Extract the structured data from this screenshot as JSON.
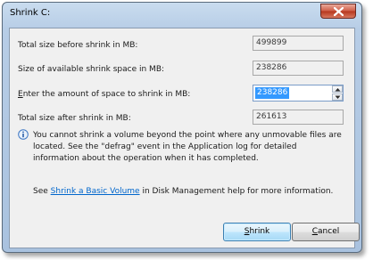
{
  "window": {
    "title": "Shrink C:"
  },
  "fields": {
    "total_size_label": "Total size before shrink in MB:",
    "total_size_value": "499899",
    "available_label": "Size of available shrink space in MB:",
    "available_value": "238286",
    "enter_label_pre": "E",
    "enter_label_rest": "nter the amount of space to shrink in MB:",
    "enter_value": "238286",
    "after_label": "Total size after shrink in MB:",
    "after_value": "261613"
  },
  "info": {
    "text": "You cannot shrink a volume beyond the point where any unmovable files are located. See the \"defrag\" event in the Application log for detailed information about the operation when it has completed."
  },
  "help": {
    "prefix": "See ",
    "link": "Shrink a Basic Volume",
    "suffix": " in Disk Management help for more information."
  },
  "buttons": {
    "shrink_mnemonic": "S",
    "shrink_rest": "hrink",
    "cancel_mnemonic": "C",
    "cancel_rest": "ancel"
  },
  "icons": {
    "close": "close-icon",
    "info": "info-icon",
    "spin_up": "chevron-up-icon",
    "spin_down": "chevron-down-icon"
  }
}
